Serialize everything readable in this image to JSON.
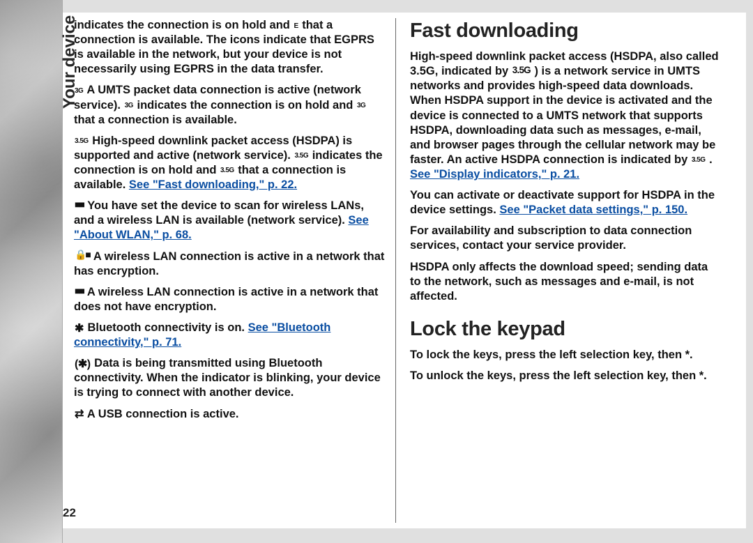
{
  "section_tab": "Your device",
  "page_number": "22",
  "left": {
    "p1_a": "indicates the connection is on hold and ",
    "p1_icon1": "E",
    "p1_b": " that a connection is available. The icons indicate that EGPRS is available in the network, but your device is not necessarily using EGPRS in the data transfer.",
    "p2_icon1": "3G",
    "p2_a": " A UMTS packet data connection is active (network service). ",
    "p2_icon2": "3G",
    "p2_b": " indicates the connection is on hold and ",
    "p2_icon3": "3G",
    "p2_c": " that a connection is available.",
    "p3_icon1": "3.5G",
    "p3_a": "  High-speed downlink packet access (HSDPA) is supported and active (network service). ",
    "p3_icon2": "3.5G",
    "p3_b": " indicates the connection is on hold and ",
    "p3_icon3": "3.5G",
    "p3_c": " that a connection is available. ",
    "p3_link": "See \"Fast downloading,\" p. 22.",
    "p4_icon": "■■",
    "p4_a": " You have set the device to scan for wireless LANs, and a wireless LAN is available (network service). ",
    "p4_link": "See \"About WLAN,\" p. 68.",
    "p5_icon": "🔒■",
    "p5_a": "  A wireless LAN connection is active in a network that has encryption.",
    "p6_icon": "■■",
    "p6_a": "  A wireless LAN connection is active in a network that does not have encryption.",
    "p7_icon": "✱",
    "p7_a": "  Bluetooth connectivity is on. ",
    "p7_link": "See \"Bluetooth connectivity,\" p. 71.",
    "p8_icon": "(✱)",
    "p8_a": "  Data is being transmitted using Bluetooth connectivity. When the indicator is blinking, your device is trying to connect with another device.",
    "p9_icon": "⇄",
    "p9_a": "  A USB connection is active."
  },
  "right": {
    "h1": "Fast downloading",
    "p1_a": "High-speed downlink packet access (HSDPA, also called 3.5G, indicated by ",
    "p1_icon": "3.5G",
    "p1_b": ") is a network service in UMTS networks and provides high-speed data downloads. When HSDPA support in the device is activated and the device is connected to a UMTS network that supports HSDPA, downloading data such as messages, e-mail, and browser pages through the cellular network may be faster. An active HSDPA connection is indicated by ",
    "p1_icon2": "3.5G",
    "p1_c": ". ",
    "p1_link": "See \"Display indicators,\" p. 21.",
    "p2_a": "You can activate or deactivate support for HSDPA in the device settings. ",
    "p2_link": "See \"Packet data settings,\" p. 150.",
    "p3": "For availability and subscription to data connection services, contact your service provider.",
    "p4": "HSDPA only affects the download speed; sending data to the network, such as messages and e-mail, is not affected.",
    "h2": "Lock the keypad",
    "p5": "To lock the keys, press the left selection key, then *.",
    "p6": "To unlock the keys, press the left selection key, then *."
  }
}
